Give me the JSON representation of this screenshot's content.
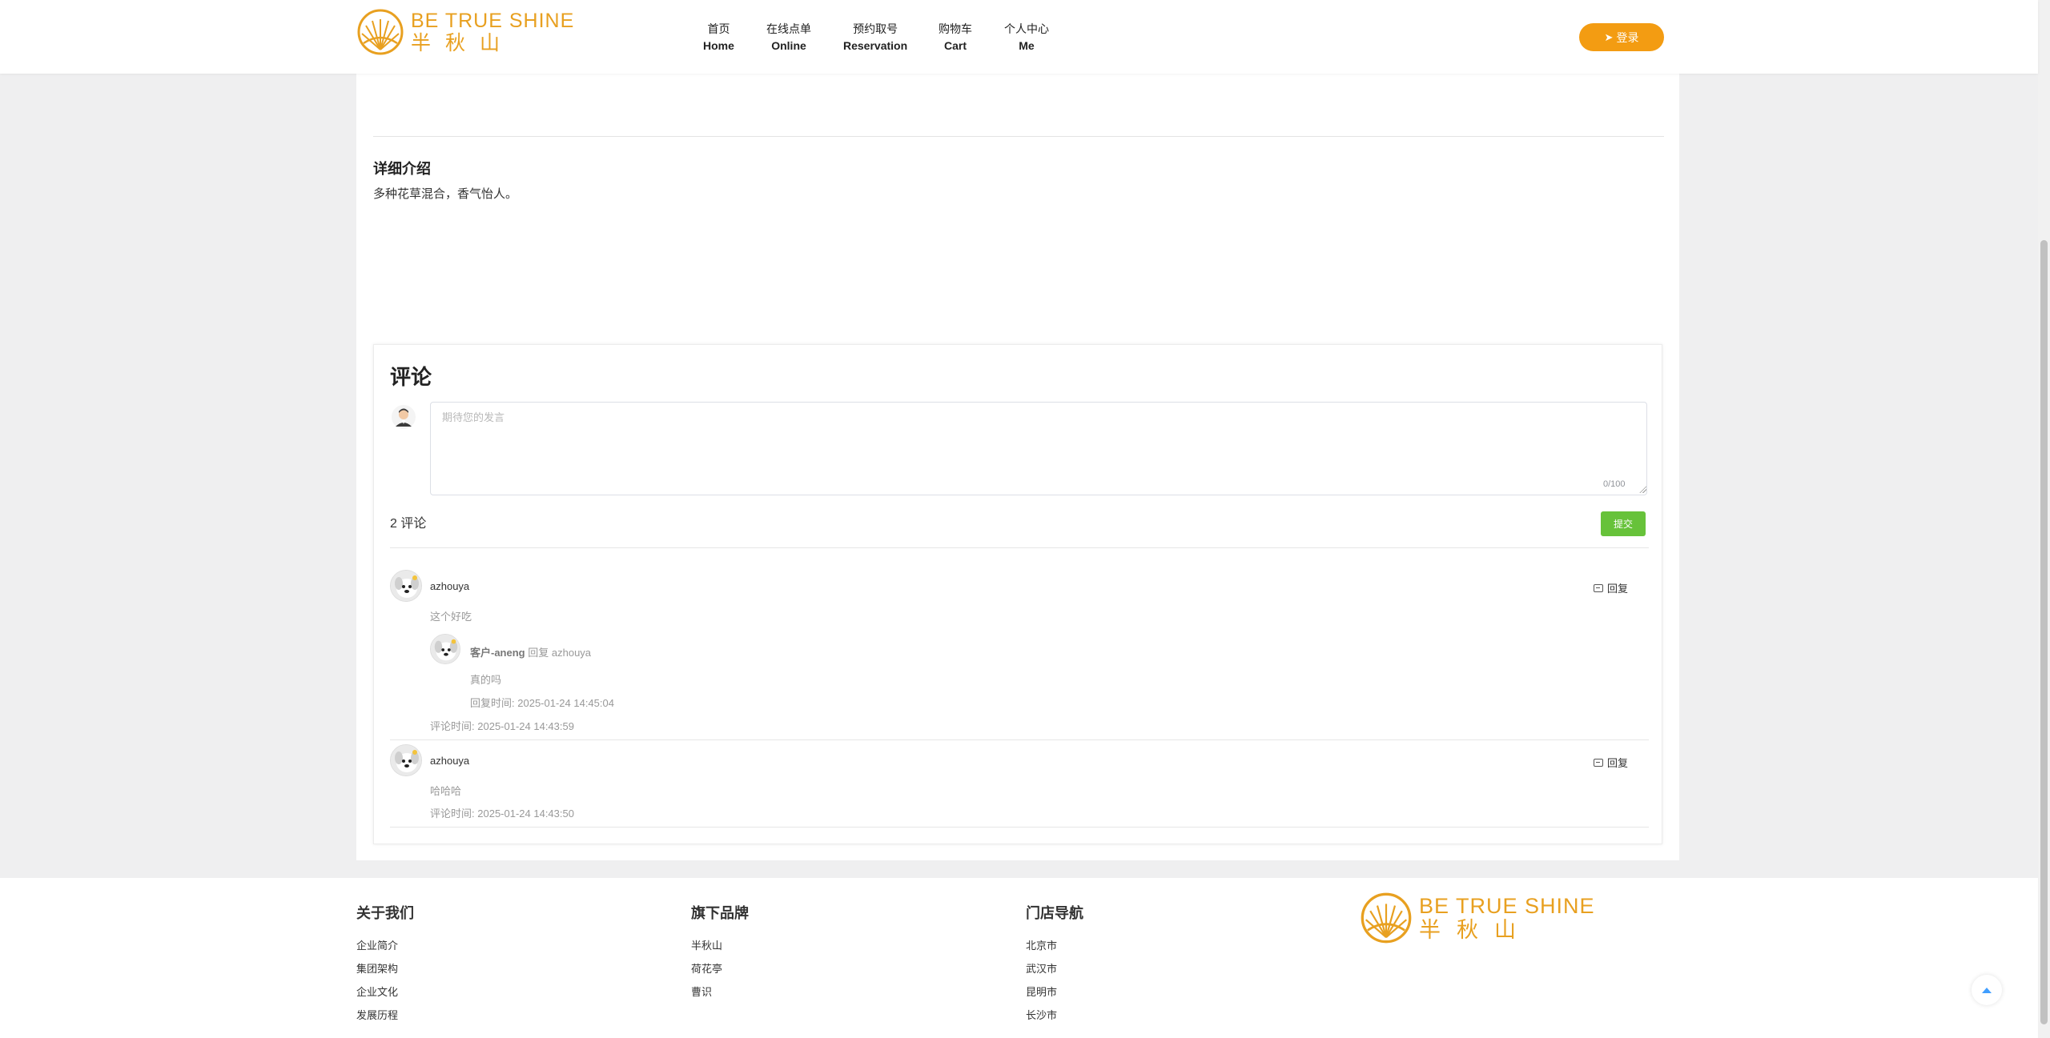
{
  "brand": {
    "name_en": "BE TRUE SHINE",
    "name_cn": "半秋山",
    "accent_color": "#e8a020"
  },
  "nav": {
    "items": [
      {
        "cn": "首页",
        "en": "Home"
      },
      {
        "cn": "在线点单",
        "en": "Online"
      },
      {
        "cn": "预约取号",
        "en": "Reservation"
      },
      {
        "cn": "购物车",
        "en": "Cart"
      },
      {
        "cn": "个人中心",
        "en": "Me"
      }
    ],
    "login_label": "登录",
    "login_color": "#f39c12"
  },
  "detail": {
    "title": "详细介绍",
    "text": "多种花草混合，香气怡人。"
  },
  "comments": {
    "title": "评论",
    "placeholder": "期待您的发言",
    "word_count": "0/100",
    "count_label": "2 评论",
    "submit_label": "提交",
    "submit_color": "#67c23a",
    "reply_label": "回复",
    "time_prefix": "评论时间:",
    "reply_time_prefix": "回复时间:",
    "items": [
      {
        "user": "azhouya",
        "text": "这个好吃",
        "time": "2025-01-24 14:43:59",
        "replies": [
          {
            "user": "客户-aneng",
            "reply_word": "回复",
            "to": "azhouya",
            "text": "真的吗",
            "time": "2025-01-24 14:45:04"
          }
        ]
      },
      {
        "user": "azhouya",
        "text": "哈哈哈",
        "time": "2025-01-24 14:43:50",
        "replies": []
      }
    ]
  },
  "footer": {
    "columns": [
      {
        "title": "关于我们",
        "links": [
          "企业简介",
          "集团架构",
          "企业文化",
          "发展历程"
        ]
      },
      {
        "title": "旗下品牌",
        "links": [
          "半秋山",
          "荷花亭",
          "曹识"
        ]
      },
      {
        "title": "门店导航",
        "links": [
          "北京市",
          "武汉市",
          "昆明市",
          "长沙市"
        ]
      }
    ]
  },
  "icons": {
    "login": "send-icon",
    "reply": "reply-icon",
    "back_to_top": "arrow-up-icon",
    "avatar": "user-avatar-icon"
  }
}
